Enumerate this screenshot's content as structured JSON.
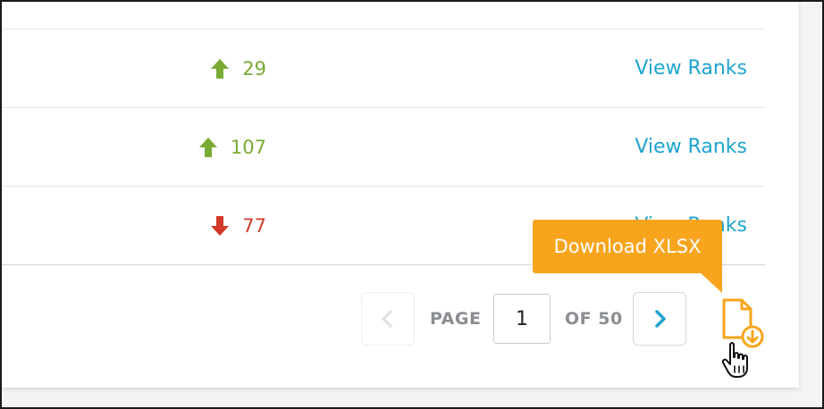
{
  "rows": [
    {
      "direction": "up",
      "change": "29",
      "link_label": "View Ranks"
    },
    {
      "direction": "up",
      "change": "107",
      "link_label": "View Ranks"
    },
    {
      "direction": "down",
      "change": "77",
      "link_label": "View Ranks"
    }
  ],
  "pagination": {
    "prev_icon": "chevron-left-icon",
    "page_label": "PAGE",
    "current_page": "1",
    "of_label": "OF 50",
    "next_icon": "chevron-right-icon"
  },
  "download": {
    "icon": "file-download-icon",
    "tooltip": "Download XLSX"
  },
  "colors": {
    "up": "#7aaa34",
    "down": "#d23a2a",
    "link": "#1ea4cf",
    "accent": "#f8a51d"
  }
}
